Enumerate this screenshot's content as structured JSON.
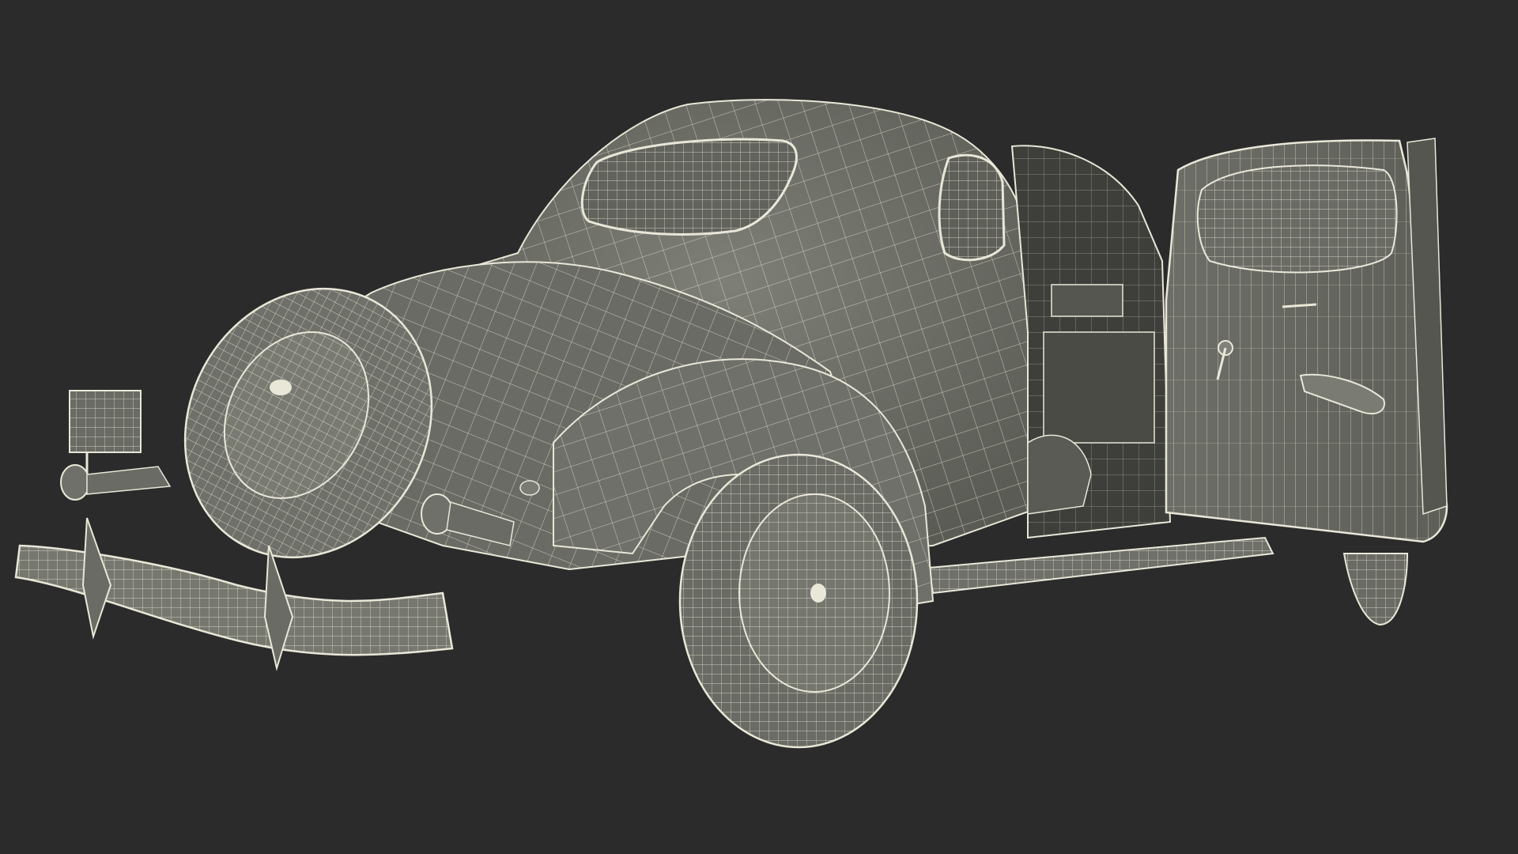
{
  "scene": {
    "subject": "wireframe-car-model",
    "colors": {
      "background": "#2b2b2b",
      "surface": "#74756d",
      "surface_shadow": "#55564f",
      "surface_dark": "#3e3f3a",
      "wire": "#e9e7d8"
    }
  }
}
